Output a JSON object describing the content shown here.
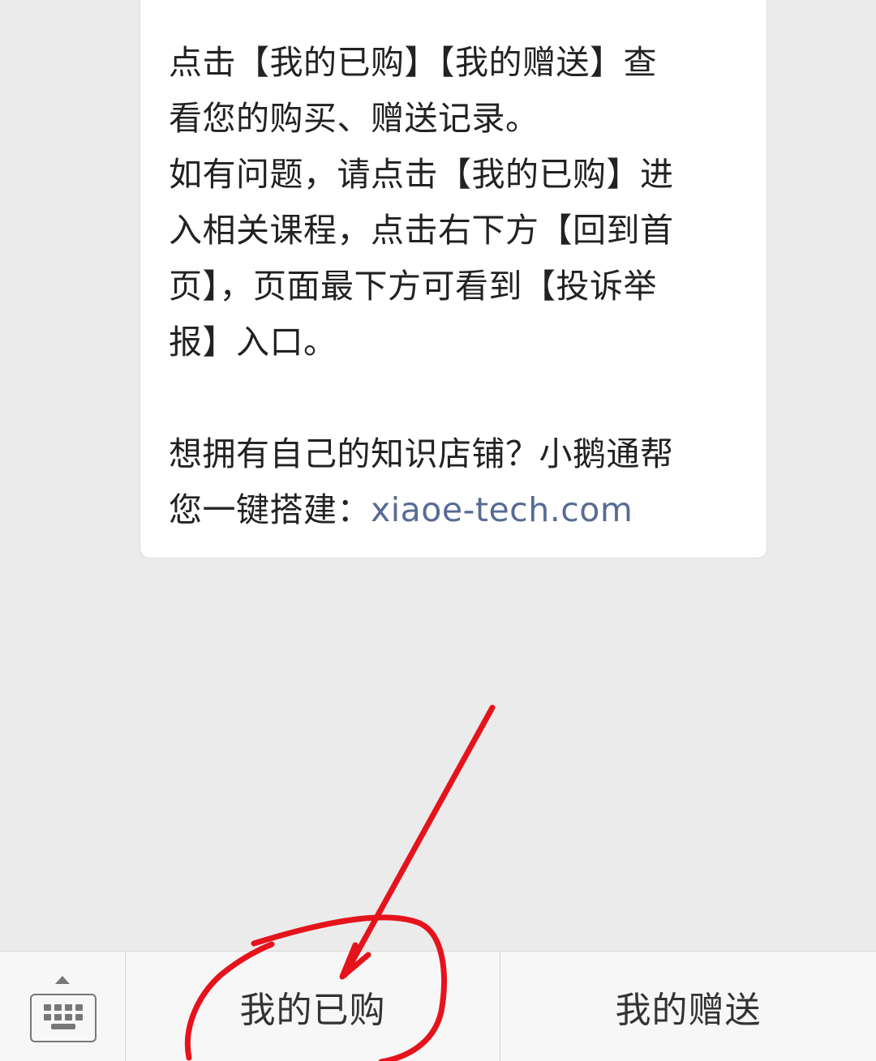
{
  "message": {
    "lines": [
      "点击【我的已购】【我的赠送】查",
      "看您的购买、赠送记录。",
      "如有问题，请点击【我的已购】进",
      "入相关课程，点击右下方【回到首",
      "页】，页面最下方可看到【投诉举",
      "报】入口。"
    ],
    "promo_line1": "想拥有自己的知识店铺？小鹅通帮",
    "promo_prefix": "您一键搭建：",
    "link_text": "xiaoe-tech.com"
  },
  "menu": {
    "purchased_label": "我的已购",
    "gifted_label": "我的赠送"
  },
  "icons": {
    "keyboard": "keyboard-icon",
    "expand": "caret-up-icon"
  },
  "colors": {
    "background": "#ebebeb",
    "bubble": "#ffffff",
    "link": "#576b95",
    "annotation": "#e5131b"
  }
}
